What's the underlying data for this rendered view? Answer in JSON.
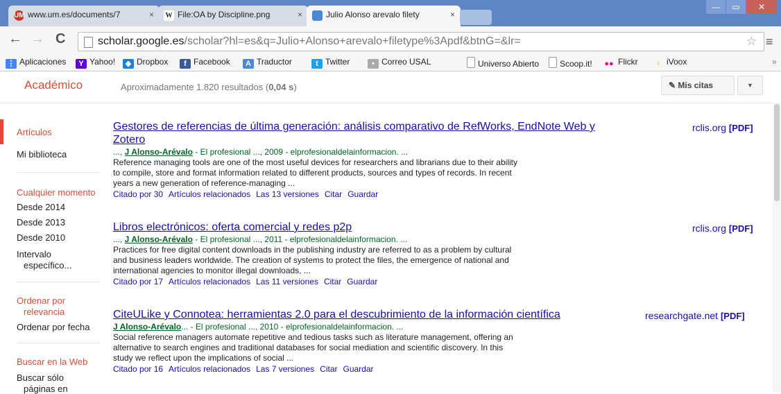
{
  "browser": {
    "tabs": [
      {
        "label": "www.um.es/documents/7",
        "favicon": "UM",
        "favicon_color": "#c0392b"
      },
      {
        "label": "File:OA by Discipline.png",
        "favicon": "W",
        "favicon_color": "#ffffff"
      },
      {
        "label": "Julio Alonso arevalo filety",
        "favicon": "scholar",
        "favicon_color": "#4a8ad4"
      }
    ],
    "tab_close": "×",
    "window_controls": [
      "—",
      "▭",
      "✕"
    ],
    "nav": {
      "back": "←",
      "forward": "→",
      "reload": "C"
    },
    "url_host": "scholar.google.es",
    "url_path": "/scholar?hl=es&q=Julio+Alonso+arevalo+filetype%3Apdf&btnG=&lr=",
    "star": "☆",
    "menu": "≡",
    "bookmarks": [
      {
        "label": "Aplicaciones",
        "icon": "apps-grid-icon",
        "color": "#4285f4"
      },
      {
        "label": "Yahoo!",
        "icon": "yahoo-icon",
        "color": "#6001d2"
      },
      {
        "label": "Dropbox",
        "icon": "dropbox-icon",
        "color": "#1f7fd6"
      },
      {
        "label": "Facebook",
        "icon": "facebook-icon",
        "color": "#3b5998"
      },
      {
        "label": "Traductor",
        "icon": "translate-icon",
        "color": "#4a8ad4"
      },
      {
        "label": "Twitter",
        "icon": "twitter-icon",
        "color": "#1da1f2"
      },
      {
        "label": "Correo USAL",
        "icon": "mail-icon",
        "color": "#999999"
      },
      {
        "label": "Universo Abierto",
        "icon": "page-icon",
        "color": "#888888"
      },
      {
        "label": "Scoop.it!",
        "icon": "page-icon",
        "color": "#888888"
      },
      {
        "label": "Flickr",
        "icon": "flickr-icon",
        "color": "#ff0084"
      },
      {
        "label": "iVoox",
        "icon": "ivoox-icon",
        "color": "#f5a623"
      }
    ],
    "more": "»"
  },
  "scholar": {
    "logo": "Académico",
    "results_prefix": "Aproximadamente 1.820 resultados (",
    "results_time": "0,04 s",
    "results_suffix": ")",
    "my_citations": "Mis citas",
    "dropdown": "▼",
    "brand_color": "#dd4b39"
  },
  "sidebar": {
    "articles": "Artículos",
    "library": "Mi biblioteca",
    "any_time": "Cualquier momento",
    "since_2014": "Desde 2014",
    "since_2013": "Desde 2013",
    "since_2010": "Desde 2010",
    "range_1": "Intervalo",
    "range_2": "específico...",
    "sort_rel_1": "Ordenar por",
    "sort_rel_2": "relevancia",
    "sort_date": "Ordenar por fecha",
    "search_web": "Buscar en la Web",
    "only_pages_1": "Buscar sólo",
    "only_pages_2": "páginas en"
  },
  "results": [
    {
      "title_1": "Gestores de referencias de última generación: análisis comparativo de RefWorks, EndNote Web y",
      "title_2": "Zotero",
      "meta_prefix": "..., ",
      "author": "J Alonso-Arévalo",
      "meta_rest": " - El profesional ..., 2009 - elprofesionaldelainformacion. ...",
      "snippet": "Reference managing tools are one of the most useful devices for researchers and librarians due to their ability to compile, store and format information related to different products, sources and types of records. In recent years a new generation of reference-managing ...",
      "links": [
        "Citado por 30",
        "Artículos relacionados",
        "Las 13 versiones",
        "Citar",
        "Guardar"
      ],
      "source": "rclis.org",
      "format": "[PDF]"
    },
    {
      "title_1": "Libros electrónicos: oferta comercial y redes p2p",
      "title_2": "",
      "meta_prefix": "..., ",
      "author": "J Alonso-Arévalo",
      "meta_rest": " - El profesional ..., 2011 - elprofesionaldelainformacion. ...",
      "snippet": "Practices for free digital content downloads in the publishing industry are referred to as a problem by cultural and business leaders worldwide. The creation of systems to protect the files, the emergence of national and international agencies to monitor illegal downloads, ...",
      "links": [
        "Citado por 17",
        "Artículos relacionados",
        "Las 11 versiones",
        "Citar",
        "Guardar"
      ],
      "source": "rclis.org",
      "format": "[PDF]"
    },
    {
      "title_1": "CiteULike y Connotea: herramientas 2.0 para el descubrimiento de la información científica",
      "title_2": "",
      "meta_prefix": "",
      "author": "J Alonso-Arévalo",
      "meta_rest": "... - El profesional ..., 2010 - elprofesionaldelainformacion. ...",
      "snippet": "Social reference managers automate repetitive and tedious tasks such as literature management, offering an alternative to search engines and traditional databases for social mediation and scientific discovery. In this study we reflect upon the implications of social ...",
      "links": [
        "Citado por 16",
        "Artículos relacionados",
        "Las 7 versiones",
        "Citar",
        "Guardar"
      ],
      "source": "researchgate.net",
      "format": "[PDF]"
    }
  ]
}
